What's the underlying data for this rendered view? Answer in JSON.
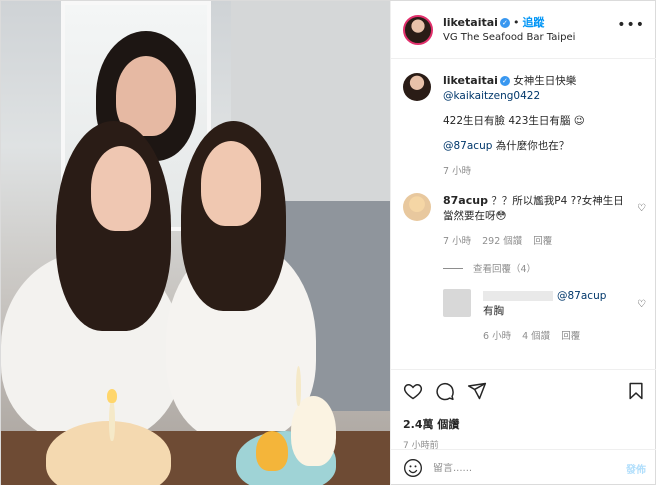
{
  "header": {
    "username": "liketaitai",
    "follow_label": "追蹤",
    "location": "VG The Seafood Bar Taipei",
    "more_icon": "more-horizontal-icon"
  },
  "caption": {
    "username": "liketaitai",
    "text1": "女神生日快樂",
    "mention1": "@kaikaitzeng0422",
    "text2": "422生日有臉 423生日有腦 😉",
    "mention2": "@87acup",
    "text3": "為什麼你也在？",
    "time": "7 小時"
  },
  "comments": [
    {
      "username": "87acup",
      "text": "？？所以尷我P4 ??女神生日當然要在呀😳",
      "time": "7 小時",
      "likes": "292 個讚",
      "reply_label": "回覆"
    }
  ],
  "view_replies": "查看回覆（4）",
  "reply": {
    "mention": "@87acup",
    "text": "有胸",
    "time": "6 小時",
    "likes": "4 個讚",
    "reply_label": "回覆"
  },
  "actions": {
    "likes_count": "2.4萬",
    "likes_suffix": "個讚",
    "timestamp": "7 小時前"
  },
  "add_comment": {
    "placeholder": "留言......",
    "post_label": "發佈"
  },
  "colors": {
    "accent": "#0095f6",
    "verified": "#3897f0",
    "story_ring": "#e1306c"
  }
}
